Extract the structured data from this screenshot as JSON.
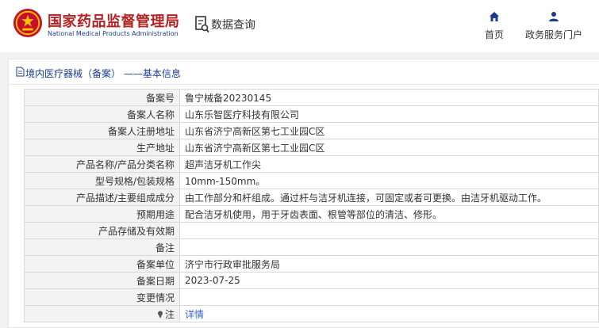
{
  "header": {
    "brand_cn": "国家药品监督管理局",
    "brand_en": "National Medical Products Administration",
    "query_label": "数据查询",
    "nav": [
      {
        "label": "首页",
        "icon": "home-icon"
      },
      {
        "label": "政务服务门户",
        "icon": "user-icon"
      }
    ]
  },
  "panel": {
    "title": "境内医疗器械（备案） ——基本信息"
  },
  "rows": [
    {
      "key": "备案号",
      "value": "鲁宁械备20230145"
    },
    {
      "key": "备案人名称",
      "value": "山东乐智医疗科技有限公司"
    },
    {
      "key": "备案人注册地址",
      "value": "山东省济宁高新区第七工业园C区"
    },
    {
      "key": "生产地址",
      "value": "山东省济宁高新区第七工业园C区"
    },
    {
      "key": "产品名称/产品分类名称",
      "value": "超声洁牙机工作尖"
    },
    {
      "key": "型号规格/包装规格",
      "value": "10mm-150mm。"
    },
    {
      "key": "产品描述/主要组成成分",
      "value": "由工作部分和杆组成。通过杆与洁牙机连接，可固定或者可更换。由洁牙机驱动工作。"
    },
    {
      "key": "预期用途",
      "value": "配合洁牙机使用，用于牙齿表面、根管等部位的清洁、修形。"
    },
    {
      "key": "产品存储及有效期",
      "value": ""
    },
    {
      "key": "备注",
      "value": ""
    },
    {
      "key": "备案单位",
      "value": "济宁市行政审批服务局"
    },
    {
      "key": "备案日期",
      "value": "2023-07-25"
    },
    {
      "key": "变更情况",
      "value": ""
    }
  ],
  "note_row": {
    "key": "注",
    "value": "详情",
    "icon": "pin-icon"
  },
  "colors": {
    "brand_red": "#b22222",
    "brand_blue": "#1a3d8f",
    "link": "#3366cc"
  }
}
